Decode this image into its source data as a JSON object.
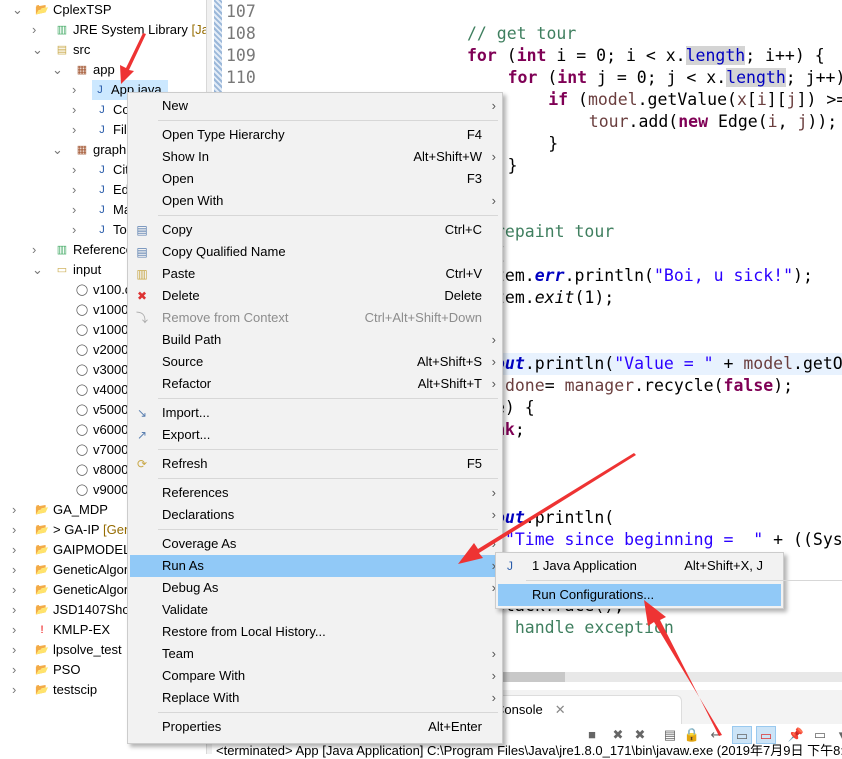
{
  "tree": [
    {
      "label": "CplexTSP",
      "icon": "project-folder-icon",
      "level": 0,
      "expanded": true
    },
    {
      "label": "JRE System Library",
      "deco": " [Java",
      "icon": "library-icon",
      "level": 1,
      "expanded": false
    },
    {
      "label": "src",
      "icon": "source-folder-icon",
      "level": 1,
      "expanded": true
    },
    {
      "label": "app",
      "icon": "package-icon",
      "level": 2,
      "expanded": true
    },
    {
      "label": "App.java",
      "icon": "java-file-icon",
      "level": 3,
      "expanded": false,
      "selected": true
    },
    {
      "label": "Cons",
      "icon": "java-file-icon",
      "level": 3,
      "expanded": false
    },
    {
      "label": "FileM",
      "icon": "java-file-icon",
      "level": 3,
      "expanded": false
    },
    {
      "label": "graph",
      "icon": "package-icon",
      "level": 2,
      "expanded": true
    },
    {
      "label": "City.j",
      "icon": "java-file-icon",
      "level": 3,
      "expanded": false
    },
    {
      "label": "Edge",
      "icon": "java-file-icon",
      "level": 3,
      "expanded": false
    },
    {
      "label": "Man",
      "icon": "java-file-icon",
      "level": 3,
      "expanded": false
    },
    {
      "label": "Tour",
      "icon": "java-file-icon",
      "level": 3,
      "expanded": false
    },
    {
      "label": "Referenced",
      "icon": "library-icon",
      "level": 1,
      "expanded": false
    },
    {
      "label": "input",
      "icon": "folder-icon",
      "level": 1,
      "expanded": true
    },
    {
      "label": "v100.csv",
      "icon": "csv-file-icon",
      "level": 2
    },
    {
      "label": "v1000.csv",
      "icon": "csv-file-icon",
      "level": 2
    },
    {
      "label": "v10000.csv",
      "icon": "csv-file-icon",
      "level": 2
    },
    {
      "label": "v2000.csv",
      "icon": "csv-file-icon",
      "level": 2
    },
    {
      "label": "v3000.csv",
      "icon": "csv-file-icon",
      "level": 2
    },
    {
      "label": "v4000.csv",
      "icon": "csv-file-icon",
      "level": 2
    },
    {
      "label": "v5000.csv",
      "icon": "csv-file-icon",
      "level": 2
    },
    {
      "label": "v6000.csv",
      "icon": "csv-file-icon",
      "level": 2
    },
    {
      "label": "v7000.csv",
      "icon": "csv-file-icon",
      "level": 2
    },
    {
      "label": "v8000.csv",
      "icon": "csv-file-icon",
      "level": 2
    },
    {
      "label": "v9000.csv",
      "icon": "csv-file-icon",
      "level": 2
    },
    {
      "label": "GA_MDP",
      "icon": "project-warning-icon",
      "level": 0,
      "expanded": false
    },
    {
      "label": "> GA-IP",
      "deco": " [Gene",
      "icon": "project-warning-icon",
      "level": 0,
      "expanded": false
    },
    {
      "label": "GAIPMODEL",
      "icon": "project-folder-icon",
      "level": 0,
      "expanded": false
    },
    {
      "label": "GeneticAlgorithm",
      "icon": "project-warning-icon",
      "level": 0,
      "expanded": false
    },
    {
      "label": "GeneticAlgorithm",
      "icon": "project-folder-icon",
      "level": 0,
      "expanded": false
    },
    {
      "label": "JSD1407Shoot",
      "icon": "project-warning-icon",
      "level": 0,
      "expanded": false
    },
    {
      "label": "KMLP-EX",
      "icon": "project-error-icon",
      "level": 0,
      "expanded": false
    },
    {
      "label": "lpsolve_test",
      "icon": "project-folder-icon",
      "level": 0,
      "expanded": false
    },
    {
      "label": "PSO",
      "icon": "project-folder-icon",
      "level": 0,
      "expanded": false
    },
    {
      "label": "testscip",
      "icon": "project-folder-icon",
      "level": 0,
      "expanded": false
    }
  ],
  "editor": {
    "line_numbers": [
      "107",
      "108",
      "109",
      "110"
    ],
    "lines": [
      {
        "row": 1,
        "col": 0,
        "tokens": [
          [
            "// get tour",
            "cm"
          ]
        ]
      },
      {
        "row": 2,
        "col": 0,
        "tokens": [
          [
            "for",
            "kw"
          ],
          [
            " (",
            "pl"
          ],
          [
            "int",
            "kw"
          ],
          [
            " i = 0; i < x.",
            "pl"
          ],
          [
            "length",
            "lenhl"
          ],
          [
            "; i++) {",
            "pl"
          ]
        ]
      },
      {
        "row": 3,
        "col": 4,
        "tokens": [
          [
            "for",
            "kw"
          ],
          [
            " (",
            "pl"
          ],
          [
            "int",
            "kw"
          ],
          [
            " j = 0; j < x.",
            "pl"
          ],
          [
            "length",
            "lenhl"
          ],
          [
            "; j++)",
            "pl"
          ]
        ]
      },
      {
        "row": 4,
        "col": 8,
        "tokens": [
          [
            "if",
            "kw"
          ],
          [
            " (",
            "pl"
          ],
          [
            "model",
            "vr"
          ],
          [
            ".getValue(",
            "pl"
          ],
          [
            "x",
            "vr"
          ],
          [
            "[",
            "pl"
          ],
          [
            "i",
            "vr"
          ],
          [
            "][",
            "pl"
          ],
          [
            "j",
            "vr"
          ],
          [
            "]) >=",
            "pl"
          ]
        ]
      },
      {
        "row": 5,
        "col": 12,
        "tokens": [
          [
            "tour",
            "vr"
          ],
          [
            ".add(",
            "pl"
          ],
          [
            "new",
            "kw"
          ],
          [
            " Edge(",
            "pl"
          ],
          [
            "i",
            "vr"
          ],
          [
            ", ",
            "pl"
          ],
          [
            "j",
            "vr"
          ],
          [
            "));",
            "pl"
          ]
        ]
      },
      {
        "row": 6,
        "col": 8,
        "tokens": [
          [
            "}",
            "pl"
          ]
        ]
      },
      {
        "row": 7,
        "col": 4,
        "tokens": [
          [
            "}",
            "pl"
          ]
        ]
      },
      {
        "row": 10,
        "col": 3,
        "tokens": [
          [
            "repaint tour",
            "cm"
          ]
        ]
      },
      {
        "row": 11,
        "col": 3,
        "tokens": [
          [
            "{",
            "pl"
          ]
        ]
      },
      {
        "row": 12,
        "col": 3,
        "tokens": [
          [
            "tem.",
            "pl"
          ],
          [
            "err",
            "fi"
          ],
          [
            ".println(",
            "pl"
          ],
          [
            "\"Boi, u sick!\"",
            "st"
          ],
          [
            ");",
            "pl"
          ]
        ]
      },
      {
        "row": 13,
        "col": 3,
        "tokens": [
          [
            "tem.",
            "pl"
          ],
          [
            "exit",
            "it"
          ],
          [
            "(1);",
            "pl"
          ]
        ]
      },
      {
        "row": 16,
        "col": 3,
        "highlight": true,
        "tokens": [
          [
            "out",
            "fi"
          ],
          [
            ".println(",
            "pl"
          ],
          [
            "\"Value = \"",
            "st"
          ],
          [
            " + ",
            "pl"
          ],
          [
            "model",
            "vr"
          ],
          [
            ".getO",
            "pl"
          ]
        ]
      },
      {
        "row": 17,
        "col": 3,
        "tokens": [
          [
            " ",
            "pl"
          ],
          [
            "done",
            "vr"
          ],
          [
            "= ",
            "pl"
          ],
          [
            "manager",
            "vr"
          ],
          [
            ".recycle(",
            "pl"
          ],
          [
            "false",
            "kw"
          ],
          [
            ");",
            "pl"
          ]
        ]
      },
      {
        "row": 18,
        "col": 3,
        "tokens": [
          [
            "e) {",
            "pl"
          ]
        ]
      },
      {
        "row": 19,
        "col": 3,
        "tokens": [
          [
            "ak",
            "kw"
          ],
          [
            ";",
            "pl"
          ]
        ]
      },
      {
        "row": 22,
        "col": 3,
        "tokens": [
          [
            ";",
            "pl"
          ]
        ]
      },
      {
        "row": 23,
        "col": 3,
        "tokens": [
          [
            "out",
            "fi"
          ],
          [
            ".println(",
            "pl"
          ]
        ]
      },
      {
        "row": 24,
        "col": 3,
        "tokens": [
          [
            " ",
            "pl"
          ],
          [
            "\"Time since beginning =  \"",
            "st"
          ],
          [
            " + ((Sys",
            "pl"
          ]
        ]
      },
      {
        "row": 26,
        "col": 3,
        "tokens": [
          [
            "out.println(e.getMessage());",
            "pl"
          ]
        ]
      },
      {
        "row": 27,
        "col": 3,
        "tokens": [
          [
            "StackTrace();",
            "pl"
          ]
        ]
      },
      {
        "row": 28,
        "col": 3,
        "tokens": [
          [
            ": handle exception",
            "cm"
          ]
        ]
      }
    ]
  },
  "console": {
    "tab_label": "Console",
    "close_icon": "close-icon",
    "status": "<terminated> App [Java Application] C:\\Program Files\\Java\\jre1.8.0_171\\bin\\javaw.exe (2019年7月9日 下午8:5",
    "toolbar": [
      "terminate-icon",
      "remove-launch-icon",
      "remove-all-terminated-icon",
      "clear-console-icon",
      "scroll-lock-icon",
      "word-wrap-icon",
      "show-on-stdout-icon",
      "show-on-stderr-icon",
      "pin-console-icon",
      "display-console-icon",
      "view-menu-icon"
    ]
  },
  "context_menu": {
    "items": [
      {
        "label": "New",
        "submenu": true
      },
      {
        "sep": true
      },
      {
        "label": "Open Type Hierarchy",
        "shortcut": "F4"
      },
      {
        "label": "Show In",
        "shortcut": "Alt+Shift+W",
        "submenu": true
      },
      {
        "label": "Open",
        "shortcut": "F3"
      },
      {
        "label": "Open With",
        "submenu": true
      },
      {
        "sep": true
      },
      {
        "label": "Copy",
        "shortcut": "Ctrl+C",
        "icon": "copy-icon"
      },
      {
        "label": "Copy Qualified Name",
        "icon": "copy-qualified-name-icon"
      },
      {
        "label": "Paste",
        "shortcut": "Ctrl+V",
        "icon": "paste-icon"
      },
      {
        "label": "Delete",
        "shortcut": "Delete",
        "icon": "delete-icon"
      },
      {
        "label": "Remove from Context",
        "shortcut": "Ctrl+Alt+Shift+Down",
        "icon": "remove-context-icon",
        "disabled": true
      },
      {
        "label": "Build Path",
        "submenu": true
      },
      {
        "label": "Source",
        "shortcut": "Alt+Shift+S",
        "submenu": true
      },
      {
        "label": "Refactor",
        "shortcut": "Alt+Shift+T",
        "submenu": true
      },
      {
        "sep": true
      },
      {
        "label": "Import...",
        "icon": "import-icon"
      },
      {
        "label": "Export...",
        "icon": "export-icon"
      },
      {
        "sep": true
      },
      {
        "label": "Refresh",
        "shortcut": "F5",
        "icon": "refresh-icon"
      },
      {
        "sep": true
      },
      {
        "label": "References",
        "submenu": true
      },
      {
        "label": "Declarations",
        "submenu": true
      },
      {
        "sep": true
      },
      {
        "label": "Coverage As",
        "submenu": true
      },
      {
        "label": "Run As",
        "submenu": true,
        "highlighted": true
      },
      {
        "label": "Debug As",
        "submenu": true
      },
      {
        "label": "Validate"
      },
      {
        "label": "Restore from Local History..."
      },
      {
        "label": "Team",
        "submenu": true
      },
      {
        "label": "Compare With",
        "submenu": true
      },
      {
        "label": "Replace With",
        "submenu": true
      },
      {
        "sep": true
      },
      {
        "label": "Properties",
        "shortcut": "Alt+Enter"
      }
    ]
  },
  "run_as_submenu": {
    "items": [
      {
        "label": "1 Java Application",
        "shortcut": "Alt+Shift+X, J",
        "icon": "java-application-icon"
      },
      {
        "sep": true
      },
      {
        "label": "Run Configurations...",
        "highlighted": true
      }
    ]
  },
  "colors": {
    "selection": "#cce8ff",
    "menu_highlight": "#91c9f7",
    "annotation_arrow": "#ee3333",
    "keyword": "#7f0055",
    "comment": "#3f7f5f",
    "string": "#2a00ff"
  }
}
